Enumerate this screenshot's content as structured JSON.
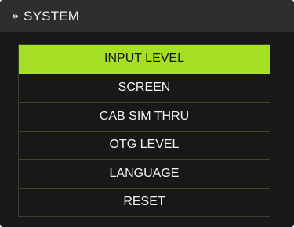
{
  "header": {
    "icon": "double-chevron-right-icon",
    "title": "SYSTEM"
  },
  "menu": {
    "items": [
      {
        "label": "INPUT LEVEL",
        "selected": true
      },
      {
        "label": "SCREEN",
        "selected": false
      },
      {
        "label": "CAB SIM THRU",
        "selected": false
      },
      {
        "label": "OTG LEVEL",
        "selected": false
      },
      {
        "label": "LANGUAGE",
        "selected": false
      },
      {
        "label": "RESET",
        "selected": false
      }
    ]
  },
  "colors": {
    "accent": "#a6e024",
    "background": "#181818",
    "header": "#2e2e2e"
  }
}
